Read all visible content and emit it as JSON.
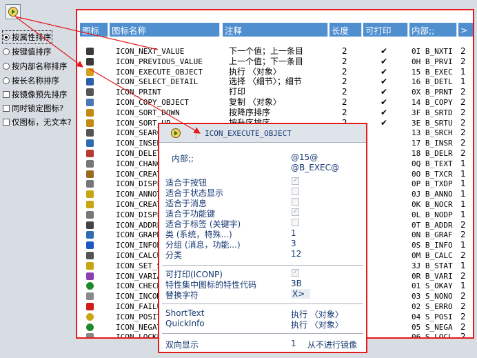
{
  "toolbar": {
    "button_icon": "execute-icon"
  },
  "sort_options": [
    {
      "label": "按属性排序",
      "kind": "radio",
      "checked": true
    },
    {
      "label": "按键值排序",
      "kind": "radio",
      "checked": false
    },
    {
      "label": "按内部名称排序",
      "kind": "radio",
      "checked": false
    },
    {
      "label": "按长名称排序",
      "kind": "radio",
      "checked": false
    },
    {
      "label": "按镜像预先排序",
      "kind": "checkbox",
      "checked": false
    },
    {
      "label": "同时锁定图标?",
      "kind": "checkbox",
      "checked": false
    },
    {
      "label": "仅图标，无文本?",
      "kind": "checkbox",
      "checked": false
    }
  ],
  "table": {
    "headers": {
      "icon": "图标",
      "name": "图标名称",
      "note": "注释",
      "length": "长度",
      "printable": "可打印",
      "internal": "内部;;",
      "more": ">"
    },
    "rows": [
      {
        "icon": "arrow-up-icon",
        "name": "ICON_NEXT_VALUE",
        "note": "下一个值；上一条目",
        "len": "2",
        "print": "✔",
        "int": "0I B_NXTI",
        "x": "2"
      },
      {
        "icon": "arrow-down-icon",
        "name": "ICON_PREVIOUS_VALUE",
        "note": "上一个值；下一条目",
        "len": "2",
        "print": "✔",
        "int": "0H B_PRVI",
        "x": "2"
      },
      {
        "icon": "execute-icon",
        "name": "ICON_EXECUTE_OBJECT",
        "note": "执行 〈对象〉",
        "len": "2",
        "print": "✔",
        "int": "15 B_EXEC",
        "x": "1"
      },
      {
        "icon": "magnifier-icon",
        "name": "ICON_SELECT_DETAIL",
        "note": "选择 〈细节〉；细节",
        "len": "2",
        "print": "✔",
        "int": "16 B_DETL",
        "x": "1"
      },
      {
        "icon": "printer-icon",
        "name": "ICON_PRINT",
        "note": "打印",
        "len": "2",
        "print": "✔",
        "int": "0X B_PRNT",
        "x": "2"
      },
      {
        "icon": "copy-icon",
        "name": "ICON_COPY_OBJECT",
        "note": "复制 〈对象〉",
        "len": "2",
        "print": "✔",
        "int": "14 B_COPY",
        "x": "2"
      },
      {
        "icon": "sort-down-icon",
        "name": "ICON_SORT_DOWN",
        "note": "按降序排序",
        "len": "2",
        "print": "✔",
        "int": "3F B_SRTD",
        "x": "2"
      },
      {
        "icon": "sort-up-icon",
        "name": "ICON_SORT_UP",
        "note": "按升序排序",
        "len": "2",
        "print": "✔",
        "int": "3E B_SRTU",
        "x": "2"
      },
      {
        "icon": "binoculars-icon",
        "name": "ICON_SEARCH",
        "note": "",
        "len": "",
        "print": "",
        "int": "13 B_SRCH",
        "x": "2"
      },
      {
        "icon": "insert-icon",
        "name": "ICON_INSERT_ROW",
        "note": "",
        "len": "",
        "print": "",
        "int": "17 B_INSR",
        "x": "2"
      },
      {
        "icon": "delete-row-icon",
        "name": "ICON_DELETE_ROW",
        "note": "",
        "len": "",
        "print": "",
        "int": "18 B_DELR",
        "x": "2"
      },
      {
        "icon": "change-text-icon",
        "name": "ICON_CHANGE_TEXT",
        "note": "",
        "len": "",
        "print": "",
        "int": "0Q B_TEXT",
        "x": "1"
      },
      {
        "icon": "create-text-icon",
        "name": "ICON_CREATE_TEXT",
        "note": "",
        "len": "",
        "print": "",
        "int": "0O B_TXCR",
        "x": "1"
      },
      {
        "icon": "display-text-icon",
        "name": "ICON_DISPLAY_TEXT",
        "note": "",
        "len": "",
        "print": "",
        "int": "0P B_TXDP",
        "x": "1"
      },
      {
        "icon": "annotation-icon",
        "name": "ICON_ANNOTATION",
        "note": "",
        "len": "",
        "print": "",
        "int": "0J B_ANNO",
        "x": "1"
      },
      {
        "icon": "create-note-icon",
        "name": "ICON_CREATE_NOTE",
        "note": "",
        "len": "",
        "print": "",
        "int": "0K B_NOCR",
        "x": "1"
      },
      {
        "icon": "display-note-icon",
        "name": "ICON_DISPLAY_NOTE",
        "note": "",
        "len": "",
        "print": "",
        "int": "0L B_NODP",
        "x": "1"
      },
      {
        "icon": "address-icon",
        "name": "ICON_ADDRESS",
        "note": "",
        "len": "",
        "print": "",
        "int": "0T B_ADDR",
        "x": "2"
      },
      {
        "icon": "graphics-icon",
        "name": "ICON_GRAPHICS",
        "note": "",
        "len": "",
        "print": "",
        "int": "0N B_GRAF",
        "x": "2"
      },
      {
        "icon": "information-icon",
        "name": "ICON_INFORMATION",
        "note": "",
        "len": "",
        "print": "",
        "int": "0S B_INFO",
        "x": "1"
      },
      {
        "icon": "calculation-icon",
        "name": "ICON_CALCULATION",
        "note": "",
        "len": "",
        "print": "",
        "int": "0M B_CALC",
        "x": "2"
      },
      {
        "icon": "set-state-icon",
        "name": "ICON_SET_STATE",
        "note": "",
        "len": "",
        "print": "",
        "int": "3J B_STAT",
        "x": "1"
      },
      {
        "icon": "variants-icon",
        "name": "ICON_VARIANTS",
        "note": "",
        "len": "",
        "print": "",
        "int": "0R B_VARI",
        "x": "2"
      },
      {
        "icon": "check-icon",
        "name": "ICON_CHECKED",
        "note": "",
        "len": "",
        "print": "",
        "int": "01 S_OKAY",
        "x": "1"
      },
      {
        "icon": "incomplete-icon",
        "name": "ICON_INCOMPLETE",
        "note": "",
        "len": "",
        "print": "",
        "int": "03 S_NONO",
        "x": "2"
      },
      {
        "icon": "failure-icon",
        "name": "ICON_FAILURE",
        "note": "",
        "len": "",
        "print": "",
        "int": "02 S_ERRO",
        "x": "2"
      },
      {
        "icon": "positive-icon",
        "name": "ICON_POSITIVE",
        "note": "",
        "len": "",
        "print": "",
        "int": "04 S_POSI",
        "x": "2"
      },
      {
        "icon": "negative-icon",
        "name": "ICON_NEGATIVE",
        "note": "",
        "len": "",
        "print": "",
        "int": "05 S_NEGA",
        "x": "2"
      },
      {
        "icon": "locked-icon",
        "name": "ICON_LOCKED",
        "note": "",
        "len": "",
        "print": "",
        "int": "06 S_LOCL",
        "x": "2"
      }
    ]
  },
  "popup": {
    "title": "ICON_EXECUTE_OBJECT",
    "internal_label": "内部;;",
    "internal_value1": "@15@",
    "internal_value2": "@B_EXEC@",
    "rows": [
      {
        "label": "适合于按钮",
        "type": "check",
        "checked": true
      },
      {
        "label": "适合于状态显示",
        "type": "check",
        "checked": false
      },
      {
        "label": "适合于消息",
        "type": "check",
        "checked": false
      },
      {
        "label": "适合于功能键",
        "type": "check",
        "checked": true
      },
      {
        "label": "适合于标签 (关键字)",
        "type": "check",
        "checked": false
      },
      {
        "label": "类 (系统，特殊...)",
        "type": "text",
        "value": "1"
      },
      {
        "label": "分组 (消息，功能...)",
        "type": "text",
        "value": "3"
      },
      {
        "label": "分类",
        "type": "text",
        "value": "12"
      }
    ],
    "print_label": "可打印(ICONP)",
    "print_checked": true,
    "charset_label": "特性集中图标的特性代码",
    "charset_value": "3B",
    "subst_label": "替换字符",
    "subst_value": "X>",
    "shorttext_label": "ShortText",
    "shorttext_value": "执行 〈对象〉",
    "quickinfo_label": "QuickInfo",
    "quickinfo_value": "执行 〈对象〉",
    "bidi_label": "双向显示",
    "bidi_value": "1",
    "bidi_text": "从不进行镜像"
  },
  "colors": {
    "header_bg": "#4f8fd0",
    "frame_red": "#e51919",
    "label_blue": "#173a73"
  }
}
